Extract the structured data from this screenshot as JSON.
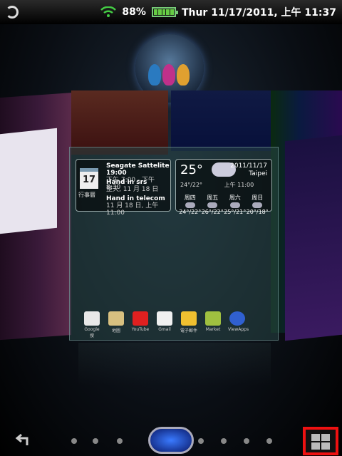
{
  "status": {
    "battery_percent": "88%",
    "datetime": "Thur 11/17/2011, 上午 11:37"
  },
  "calendar_widget": {
    "day": "17",
    "sub": "行事曆",
    "events": [
      {
        "title": "Seagate Sattelite 19:00",
        "detail": "下午 7:00 - 下午 8:30"
      },
      {
        "title": "Hand in srs",
        "detail": "整天, 11 月 18 日"
      },
      {
        "title": "Hand in telecom",
        "detail": "11 月 18 日, 上午 11:00"
      }
    ]
  },
  "weather_widget": {
    "temp": "25°",
    "date": "2011/11/17",
    "city": "Taipei",
    "range": "24°/22°",
    "updated": "上午 11:00",
    "days": [
      {
        "name": "周四",
        "temps": "24°/22°"
      },
      {
        "name": "周五",
        "temps": "26°/22°"
      },
      {
        "name": "周六",
        "temps": "25°/21°"
      },
      {
        "name": "周日",
        "temps": "20°/18°"
      }
    ]
  },
  "dock_apps": [
    {
      "label": "Google 搜",
      "color": "#e8e8e8"
    },
    {
      "label": "地圖",
      "color": "#d8c080"
    },
    {
      "label": "YouTube",
      "color": "#e02020"
    },
    {
      "label": "Gmail",
      "color": "#f0f0f0"
    },
    {
      "label": "電子郵件",
      "color": "#f0c030"
    },
    {
      "label": "Market",
      "color": "#a0c040"
    },
    {
      "label": "ViewApps",
      "color": "#3060d0"
    }
  ]
}
